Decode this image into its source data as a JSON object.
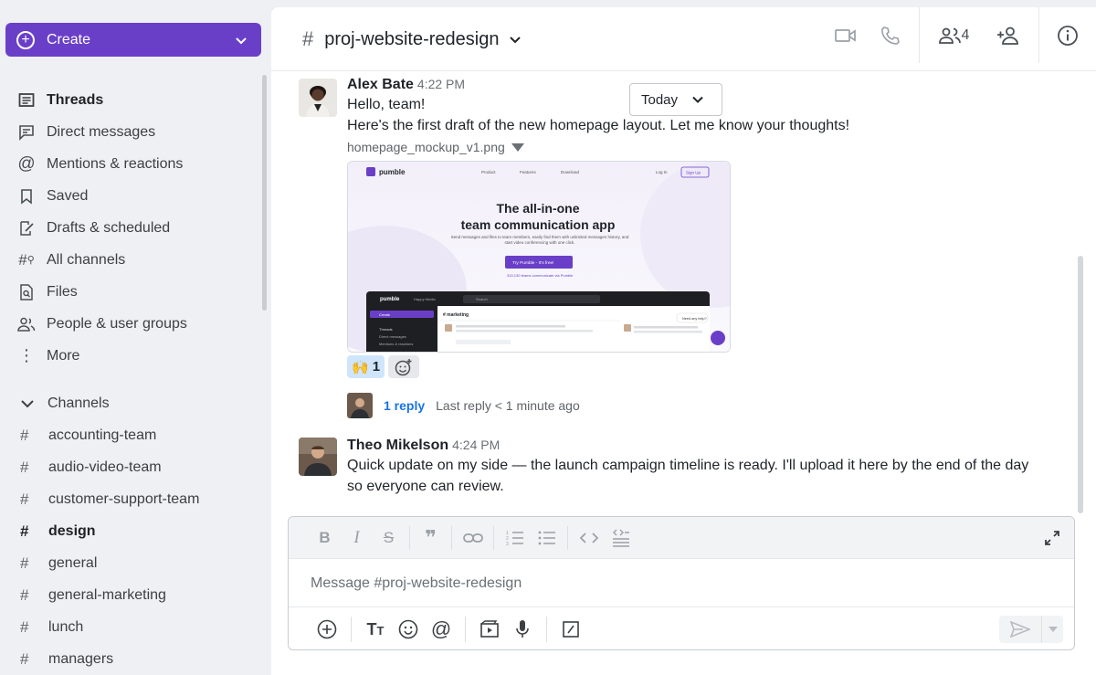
{
  "sidebar": {
    "create_label": "Create",
    "nav": [
      {
        "label": "Threads",
        "icon": "threads-icon",
        "bold": true
      },
      {
        "label": "Direct messages",
        "icon": "direct-messages-icon"
      },
      {
        "label": "Mentions & reactions",
        "icon": "at-icon"
      },
      {
        "label": "Saved",
        "icon": "bookmark-icon"
      },
      {
        "label": "Drafts & scheduled",
        "icon": "draft-icon"
      },
      {
        "label": "All channels",
        "icon": "channel-search-icon"
      },
      {
        "label": "Files",
        "icon": "file-search-icon"
      },
      {
        "label": "People & user groups",
        "icon": "people-icon"
      },
      {
        "label": "More",
        "icon": "more-vertical-icon"
      }
    ],
    "channels_label": "Channels",
    "channels": [
      {
        "name": "accounting-team"
      },
      {
        "name": "audio-video-team"
      },
      {
        "name": "customer-support-team"
      },
      {
        "name": "design",
        "bold": true
      },
      {
        "name": "general"
      },
      {
        "name": "general-marketing"
      },
      {
        "name": "lunch"
      },
      {
        "name": "managers"
      }
    ]
  },
  "header": {
    "channel_name": "proj-website-redesign",
    "member_count": "4"
  },
  "date_picker": {
    "label": "Today"
  },
  "messages": [
    {
      "author": "Alex Bate",
      "time": "4:22 PM",
      "lines": [
        "Hello, team!",
        "Here's the first draft of the new homepage layout. Let me know your thoughts!"
      ],
      "attachment": {
        "file_name": "homepage_mockup_v1.png",
        "preview": {
          "logo": "pumble",
          "nav": [
            "Product",
            "Features",
            "Download"
          ],
          "login": "Log In",
          "signup": "Sign Up",
          "headline_1": "The all-in-one",
          "headline_2": "team communication app",
          "sub": "Send messages and files to team members, easily find them with unlimited messages history, and start video conferencing with one click.",
          "cta": "Try Pumble - It's free!",
          "teams": "310,130 teams communicate via Pumble",
          "app_channel": "# marketing",
          "app_search": "Search",
          "app_workspace": "Happy Media",
          "app_create": "Create",
          "app_threads": "Threads",
          "app_dm": "Direct messages",
          "app_mentions": "Mentions & reactions",
          "help": "Need any help?"
        }
      },
      "reaction": {
        "emoji": "🙌",
        "count": "1"
      },
      "thread": {
        "replies": "1 reply",
        "meta": "Last reply < 1 minute ago"
      }
    },
    {
      "author": "Theo Mikelson",
      "time": "4:24 PM",
      "lines": [
        "Quick update on my side — the launch campaign timeline is ready. I'll upload it here by the end of the day",
        "so everyone can review."
      ]
    }
  ],
  "composer": {
    "placeholder": "Message #proj-website-redesign"
  },
  "colors": {
    "accent": "#6a3fc8",
    "link": "#1a73e8",
    "reaction_bg": "#cfe5fb"
  }
}
